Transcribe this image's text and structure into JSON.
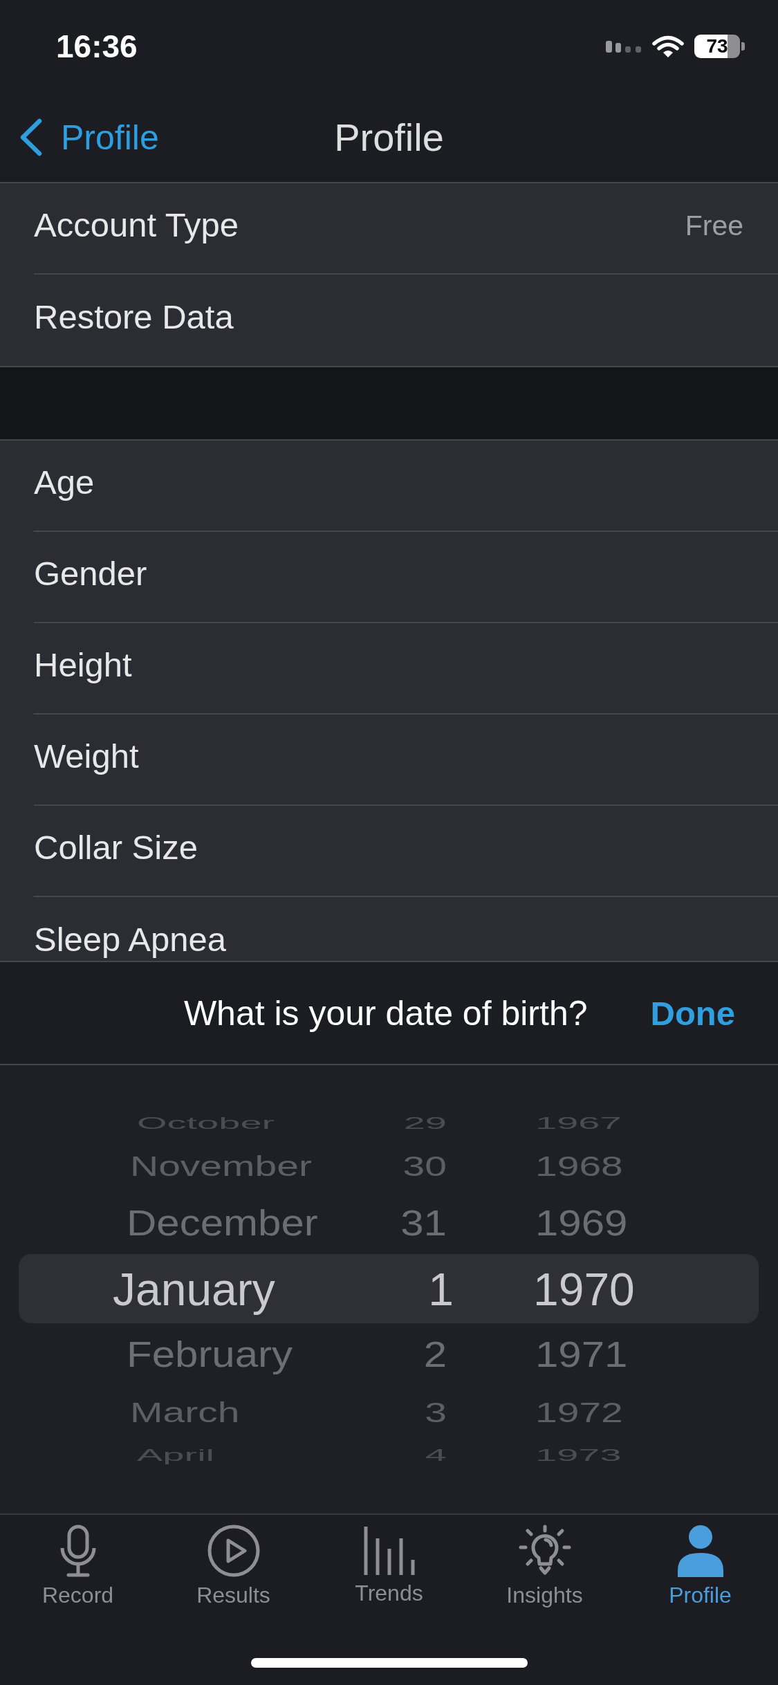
{
  "status_bar": {
    "time": "16:36",
    "battery": "73"
  },
  "nav_bar": {
    "back": "Profile",
    "title": "Profile"
  },
  "sections": [
    {
      "rows": [
        {
          "label": "Account Type",
          "value": "Free"
        },
        {
          "label": "Restore Data"
        }
      ]
    },
    {
      "rows": [
        {
          "label": "Age"
        },
        {
          "label": "Gender"
        },
        {
          "label": "Height"
        },
        {
          "label": "Weight"
        },
        {
          "label": "Collar Size"
        },
        {
          "label": "Sleep Apnea"
        }
      ]
    }
  ],
  "picker_toolbar": {
    "prompt": "What is your date of birth?",
    "done": "Done"
  },
  "date_picker": {
    "columns": [
      {
        "kind": "month",
        "items": [
          {
            "label": "October",
            "selected": false
          },
          {
            "label": "November",
            "selected": false
          },
          {
            "label": "December",
            "selected": false
          },
          {
            "label": "January",
            "selected": true
          },
          {
            "label": "February",
            "selected": false
          },
          {
            "label": "March",
            "selected": false
          },
          {
            "label": "April",
            "selected": false
          }
        ]
      },
      {
        "kind": "day",
        "items": [
          {
            "label": "29",
            "selected": false
          },
          {
            "label": "30",
            "selected": false
          },
          {
            "label": "31",
            "selected": false
          },
          {
            "label": "1",
            "selected": true
          },
          {
            "label": "2",
            "selected": false
          },
          {
            "label": "3",
            "selected": false
          },
          {
            "label": "4",
            "selected": false
          }
        ]
      },
      {
        "kind": "year",
        "items": [
          {
            "label": "1967",
            "selected": false
          },
          {
            "label": "1968",
            "selected": false
          },
          {
            "label": "1969",
            "selected": false
          },
          {
            "label": "1970",
            "selected": true
          },
          {
            "label": "1971",
            "selected": false
          },
          {
            "label": "1972",
            "selected": false
          },
          {
            "label": "1973",
            "selected": false
          }
        ]
      }
    ]
  },
  "tab_bar": {
    "tabs": [
      {
        "label": "Record",
        "selected": false
      },
      {
        "label": "Results",
        "selected": false
      },
      {
        "label": "Trends",
        "selected": false
      },
      {
        "label": "Insights",
        "selected": false
      },
      {
        "label": "Profile",
        "selected": true
      }
    ]
  }
}
